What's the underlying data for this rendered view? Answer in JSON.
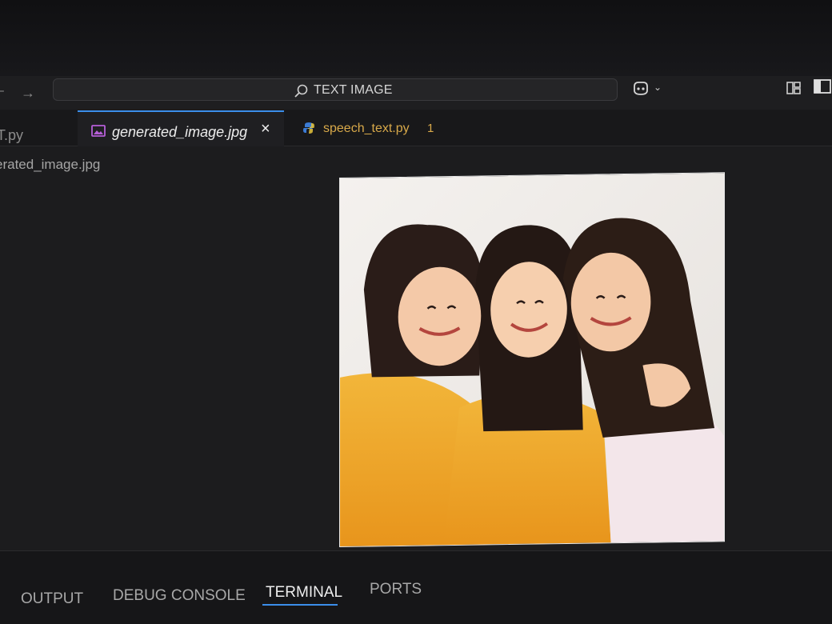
{
  "title_bar": {
    "search_label": "TEXT IMAGE",
    "back_icon": "arrow-left-icon",
    "forward_icon": "arrow-right-icon",
    "copilot_icon": "copilot-icon",
    "layout_icon": "layout-icon",
    "sidebar_icon": "sidebar-toggle-icon"
  },
  "tabs": [
    {
      "label": "T.py",
      "state": "partial"
    },
    {
      "label": "generated_image.jpg",
      "state": "active",
      "icon": "image-file-icon",
      "close": "×"
    },
    {
      "label": "speech_text.py",
      "state": "inactive",
      "icon": "python-icon",
      "problems": "1"
    }
  ],
  "breadcrumb": "erated_image.jpg",
  "image_preview": {
    "description_icon": "photo-preview"
  },
  "panel": {
    "tabs": [
      {
        "label": "OUTPUT"
      },
      {
        "label": "DEBUG CONSOLE"
      },
      {
        "label": "TERMINAL",
        "active": true
      },
      {
        "label": "PORTS"
      }
    ]
  },
  "colors": {
    "accent": "#3b8eea",
    "warning_text": "#d8a94a",
    "background": "#1c1c1e"
  }
}
